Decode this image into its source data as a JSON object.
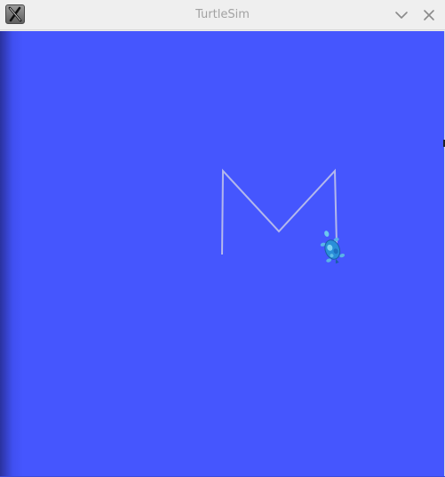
{
  "window": {
    "title": "TurtleSim",
    "icon": "x-window-icon",
    "controls": {
      "minimize_icon": "chevron-down-icon",
      "close_icon": "close-icon"
    }
  },
  "canvas": {
    "background_color": "#4556fe",
    "pen_color": "#b3b8ec",
    "turtle_color": "#2a8fd8",
    "turtle_icon": "turtle-icon",
    "path_shape": "M"
  }
}
